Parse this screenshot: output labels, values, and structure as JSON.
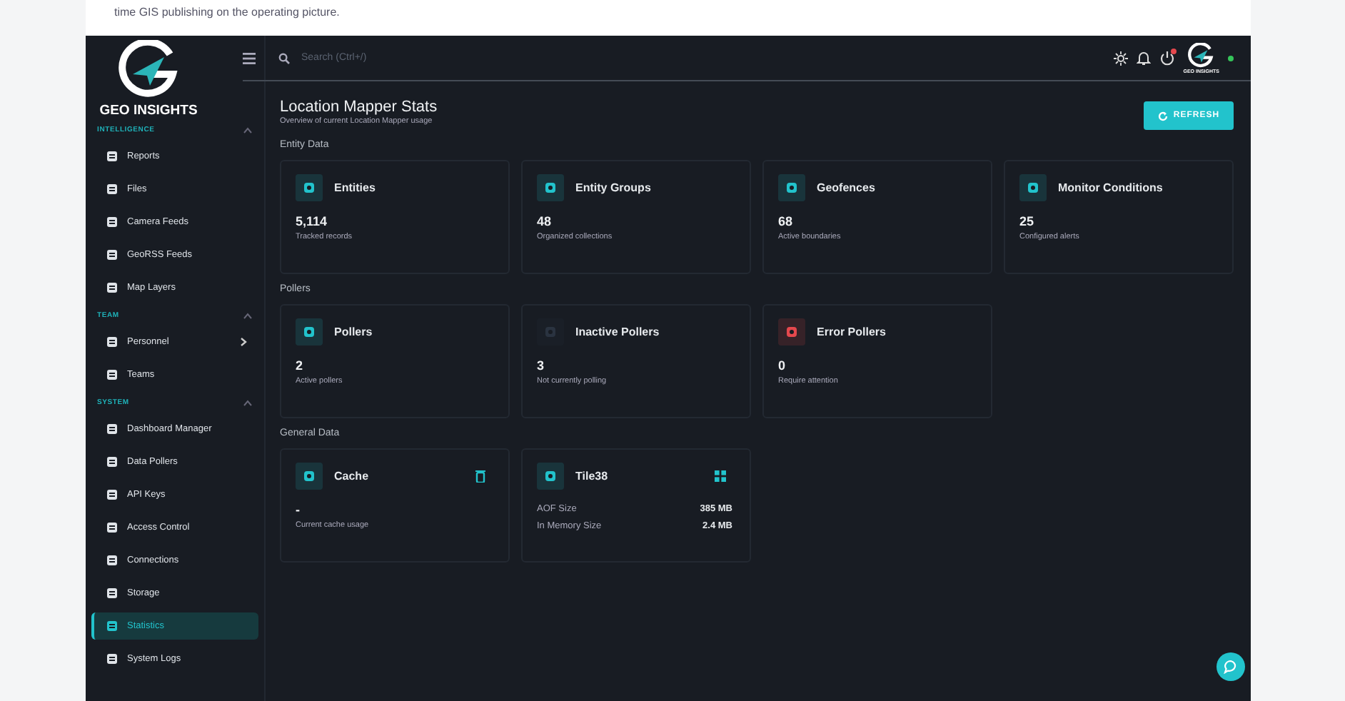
{
  "caption": "time GIS publishing on the operating picture.",
  "brand": {
    "name": "GEO INSIGHTS"
  },
  "search": {
    "placeholder": "Search (Ctrl+/)"
  },
  "header": {
    "notification_dot": true,
    "online": true,
    "brand_small": "GEO INSIGHTS"
  },
  "sidebar": [
    {
      "title": "INTELLIGENCE",
      "expanded": true,
      "items": [
        {
          "label": "Reports",
          "selected": false
        },
        {
          "label": "Files",
          "selected": false
        },
        {
          "label": "Camera Feeds",
          "selected": false
        },
        {
          "label": "GeoRSS Feeds",
          "selected": false
        },
        {
          "label": "Map Layers",
          "selected": false
        }
      ]
    },
    {
      "title": "TEAM",
      "expanded": true,
      "items": [
        {
          "label": "Personnel",
          "selected": false,
          "has_submenu": true
        },
        {
          "label": "Teams",
          "selected": false
        }
      ]
    },
    {
      "title": "SYSTEM",
      "expanded": true,
      "items": [
        {
          "label": "Dashboard Manager",
          "selected": false
        },
        {
          "label": "Data Pollers",
          "selected": false
        },
        {
          "label": "API Keys",
          "selected": false
        },
        {
          "label": "Access Control",
          "selected": false
        },
        {
          "label": "Connections",
          "selected": false
        },
        {
          "label": "Storage",
          "selected": false
        },
        {
          "label": "Statistics",
          "selected": true
        },
        {
          "label": "System Logs",
          "selected": false
        }
      ]
    }
  ],
  "page": {
    "title": "Location Mapper Stats",
    "subtitle": "Overview of current Location Mapper usage",
    "refresh_button": "REFRESH"
  },
  "sections": [
    {
      "title": "Entity Data",
      "cards": [
        {
          "kind": "stat",
          "title": "Entities",
          "value": "5,114",
          "caption": "Tracked records",
          "color": "#22c3cc"
        },
        {
          "kind": "stat",
          "title": "Entity Groups",
          "value": "48",
          "caption": "Organized collections",
          "color": "#22c3cc"
        },
        {
          "kind": "stat",
          "title": "Geofences",
          "value": "68",
          "caption": "Active boundaries",
          "color": "#22c3cc"
        },
        {
          "kind": "stat",
          "title": "Monitor Conditions",
          "value": "25",
          "caption": "Configured alerts",
          "color": "#22c3cc"
        }
      ]
    },
    {
      "title": "Pollers",
      "cards": [
        {
          "kind": "stat",
          "title": "Pollers",
          "value": "2",
          "caption": "Active pollers",
          "color": "#22c3cc"
        },
        {
          "kind": "stat",
          "title": "Inactive Pollers",
          "value": "3",
          "caption": "Not currently polling",
          "color": "#2a3340"
        },
        {
          "kind": "stat",
          "title": "Error Pollers",
          "value": "0",
          "caption": "Require attention",
          "color": "#e5484d"
        }
      ]
    },
    {
      "title": "General Data",
      "cards": [
        {
          "kind": "cache",
          "title": "Cache",
          "value": "-",
          "caption": "Current cache usage",
          "color": "#22c3cc"
        },
        {
          "kind": "table",
          "title": "Tile38",
          "color": "#22c3cc",
          "rows": [
            {
              "label": "AOF Size",
              "value": "385 MB"
            },
            {
              "label": "In Memory Size",
              "value": "2.4 MB"
            }
          ]
        }
      ]
    }
  ]
}
